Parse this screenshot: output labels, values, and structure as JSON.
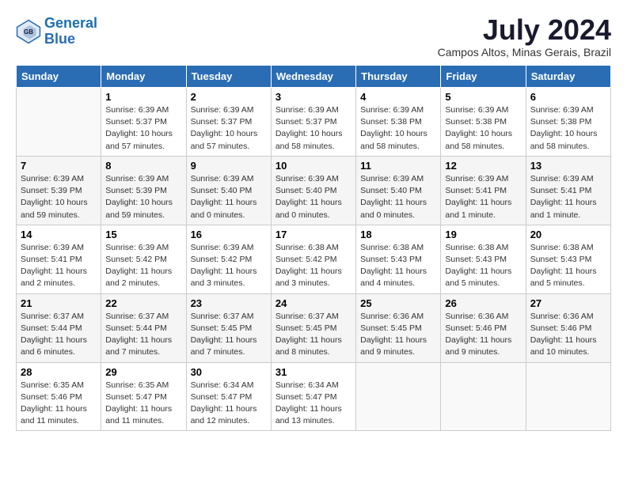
{
  "header": {
    "logo_line1": "General",
    "logo_line2": "Blue",
    "month_year": "July 2024",
    "location": "Campos Altos, Minas Gerais, Brazil"
  },
  "weekdays": [
    "Sunday",
    "Monday",
    "Tuesday",
    "Wednesday",
    "Thursday",
    "Friday",
    "Saturday"
  ],
  "weeks": [
    [
      {
        "day": "",
        "info": ""
      },
      {
        "day": "1",
        "info": "Sunrise: 6:39 AM\nSunset: 5:37 PM\nDaylight: 10 hours\nand 57 minutes."
      },
      {
        "day": "2",
        "info": "Sunrise: 6:39 AM\nSunset: 5:37 PM\nDaylight: 10 hours\nand 57 minutes."
      },
      {
        "day": "3",
        "info": "Sunrise: 6:39 AM\nSunset: 5:37 PM\nDaylight: 10 hours\nand 58 minutes."
      },
      {
        "day": "4",
        "info": "Sunrise: 6:39 AM\nSunset: 5:38 PM\nDaylight: 10 hours\nand 58 minutes."
      },
      {
        "day": "5",
        "info": "Sunrise: 6:39 AM\nSunset: 5:38 PM\nDaylight: 10 hours\nand 58 minutes."
      },
      {
        "day": "6",
        "info": "Sunrise: 6:39 AM\nSunset: 5:38 PM\nDaylight: 10 hours\nand 58 minutes."
      }
    ],
    [
      {
        "day": "7",
        "info": "Sunrise: 6:39 AM\nSunset: 5:39 PM\nDaylight: 10 hours\nand 59 minutes."
      },
      {
        "day": "8",
        "info": "Sunrise: 6:39 AM\nSunset: 5:39 PM\nDaylight: 10 hours\nand 59 minutes."
      },
      {
        "day": "9",
        "info": "Sunrise: 6:39 AM\nSunset: 5:40 PM\nDaylight: 11 hours\nand 0 minutes."
      },
      {
        "day": "10",
        "info": "Sunrise: 6:39 AM\nSunset: 5:40 PM\nDaylight: 11 hours\nand 0 minutes."
      },
      {
        "day": "11",
        "info": "Sunrise: 6:39 AM\nSunset: 5:40 PM\nDaylight: 11 hours\nand 0 minutes."
      },
      {
        "day": "12",
        "info": "Sunrise: 6:39 AM\nSunset: 5:41 PM\nDaylight: 11 hours\nand 1 minute."
      },
      {
        "day": "13",
        "info": "Sunrise: 6:39 AM\nSunset: 5:41 PM\nDaylight: 11 hours\nand 1 minute."
      }
    ],
    [
      {
        "day": "14",
        "info": "Sunrise: 6:39 AM\nSunset: 5:41 PM\nDaylight: 11 hours\nand 2 minutes."
      },
      {
        "day": "15",
        "info": "Sunrise: 6:39 AM\nSunset: 5:42 PM\nDaylight: 11 hours\nand 2 minutes."
      },
      {
        "day": "16",
        "info": "Sunrise: 6:39 AM\nSunset: 5:42 PM\nDaylight: 11 hours\nand 3 minutes."
      },
      {
        "day": "17",
        "info": "Sunrise: 6:38 AM\nSunset: 5:42 PM\nDaylight: 11 hours\nand 3 minutes."
      },
      {
        "day": "18",
        "info": "Sunrise: 6:38 AM\nSunset: 5:43 PM\nDaylight: 11 hours\nand 4 minutes."
      },
      {
        "day": "19",
        "info": "Sunrise: 6:38 AM\nSunset: 5:43 PM\nDaylight: 11 hours\nand 5 minutes."
      },
      {
        "day": "20",
        "info": "Sunrise: 6:38 AM\nSunset: 5:43 PM\nDaylight: 11 hours\nand 5 minutes."
      }
    ],
    [
      {
        "day": "21",
        "info": "Sunrise: 6:37 AM\nSunset: 5:44 PM\nDaylight: 11 hours\nand 6 minutes."
      },
      {
        "day": "22",
        "info": "Sunrise: 6:37 AM\nSunset: 5:44 PM\nDaylight: 11 hours\nand 7 minutes."
      },
      {
        "day": "23",
        "info": "Sunrise: 6:37 AM\nSunset: 5:45 PM\nDaylight: 11 hours\nand 7 minutes."
      },
      {
        "day": "24",
        "info": "Sunrise: 6:37 AM\nSunset: 5:45 PM\nDaylight: 11 hours\nand 8 minutes."
      },
      {
        "day": "25",
        "info": "Sunrise: 6:36 AM\nSunset: 5:45 PM\nDaylight: 11 hours\nand 9 minutes."
      },
      {
        "day": "26",
        "info": "Sunrise: 6:36 AM\nSunset: 5:46 PM\nDaylight: 11 hours\nand 9 minutes."
      },
      {
        "day": "27",
        "info": "Sunrise: 6:36 AM\nSunset: 5:46 PM\nDaylight: 11 hours\nand 10 minutes."
      }
    ],
    [
      {
        "day": "28",
        "info": "Sunrise: 6:35 AM\nSunset: 5:46 PM\nDaylight: 11 hours\nand 11 minutes."
      },
      {
        "day": "29",
        "info": "Sunrise: 6:35 AM\nSunset: 5:47 PM\nDaylight: 11 hours\nand 11 minutes."
      },
      {
        "day": "30",
        "info": "Sunrise: 6:34 AM\nSunset: 5:47 PM\nDaylight: 11 hours\nand 12 minutes."
      },
      {
        "day": "31",
        "info": "Sunrise: 6:34 AM\nSunset: 5:47 PM\nDaylight: 11 hours\nand 13 minutes."
      },
      {
        "day": "",
        "info": ""
      },
      {
        "day": "",
        "info": ""
      },
      {
        "day": "",
        "info": ""
      }
    ]
  ]
}
